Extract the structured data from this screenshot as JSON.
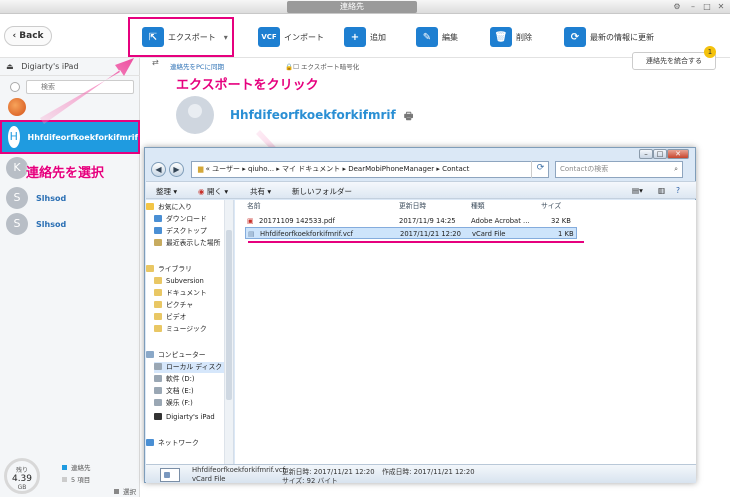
{
  "window": {
    "title": "連絡先"
  },
  "toolbar": {
    "back_label": "Back",
    "export_label": "エクスポート",
    "import_label": "インポート",
    "add_label": "追加",
    "edit_label": "編集",
    "delete_label": "削除",
    "refresh_label": "最新の情報に更新"
  },
  "sidebar": {
    "device_name": "Digiarty's iPad",
    "search_placeholder": "検索",
    "contacts": [
      {
        "initial": "H",
        "name": "Hhfdifeorfkoekforkifmrif"
      },
      {
        "initial": "K",
        "name": ""
      },
      {
        "initial": "S",
        "name": "Slhsod"
      },
      {
        "initial": "S",
        "name": "Slhsod"
      }
    ],
    "storage": {
      "label": "残り",
      "value": "4.39",
      "unit": "GB"
    },
    "legend": [
      {
        "label": "連絡先",
        "color": "#1f9be0"
      },
      {
        "label": "5 項目",
        "color": "#cccccc"
      },
      {
        "label": "選択済",
        "color": "#888888"
      }
    ]
  },
  "main": {
    "sync_label": "連絡先をPCに同期",
    "encrypt_label": "エクスポート暗号化",
    "merge_label": "連絡先を統合する",
    "merge_badge": "1",
    "contact_name": "Hhfdifeorfkoekforkifmrif"
  },
  "annotations": {
    "export_click": "エクスポートをクリック",
    "select_contact": "連絡先を選択"
  },
  "explorer": {
    "address": "« ユーザー ▸ qiuho... ▸ マイ ドキュメント ▸ DearMobiPhoneManager ▸ Contact",
    "search_placeholder": "Contactの検索",
    "commands": [
      "整理 ▾",
      "開く ▾",
      "共有 ▾",
      "新しいフォルダー"
    ],
    "nav": [
      {
        "label": "お気に入り",
        "color": "#f3c546",
        "group": true
      },
      {
        "label": "ダウンロード",
        "color": "#4a8fd4"
      },
      {
        "label": "デスクトップ",
        "color": "#4a8fd4"
      },
      {
        "label": "最近表示した場所",
        "color": "#c7ab5f"
      },
      {
        "label": "ライブラリ",
        "color": "#e9c764",
        "group": true
      },
      {
        "label": "Subversion",
        "color": "#e9c764"
      },
      {
        "label": "ドキュメント",
        "color": "#e9c764"
      },
      {
        "label": "ピクチャ",
        "color": "#e9c764"
      },
      {
        "label": "ビデオ",
        "color": "#e9c764"
      },
      {
        "label": "ミュージック",
        "color": "#e9c764"
      },
      {
        "label": "コンピューター",
        "color": "#8aa8c8",
        "group": true
      },
      {
        "label": "ローカル ディスク",
        "color": "#9aa7b4"
      },
      {
        "label": "軟件 (D:)",
        "color": "#9aa7b4"
      },
      {
        "label": "文档 (E:)",
        "color": "#9aa7b4"
      },
      {
        "label": "娱乐 (F:)",
        "color": "#9aa7b4"
      },
      {
        "label": "Digiarty's iPad",
        "color": "#333333"
      },
      {
        "label": "ネットワーク",
        "color": "#4a8fd4",
        "group": true
      }
    ],
    "columns": [
      "名前",
      "更新日時",
      "種類",
      "サイズ"
    ],
    "files": [
      {
        "name": "20171109 142533.pdf",
        "modified": "2017/11/9 14:25",
        "type": "Adobe Acrobat ...",
        "size": "32 KB",
        "icon_color": "#c8312a"
      },
      {
        "name": "Hhfdifeorfkoekforkifmrif.vcf",
        "modified": "2017/11/21 12:20",
        "type": "vCard File",
        "size": "1 KB",
        "icon_color": "#6b86a8"
      }
    ],
    "details": {
      "filename": "Hhfdifeorfkoekforkifmrif.vcf",
      "modified": "更新日時: 2017/11/21 12:20",
      "created": "作成日時: 2017/11/21 12:20",
      "type": "vCard File",
      "size": "サイズ: 92 バイト"
    }
  }
}
